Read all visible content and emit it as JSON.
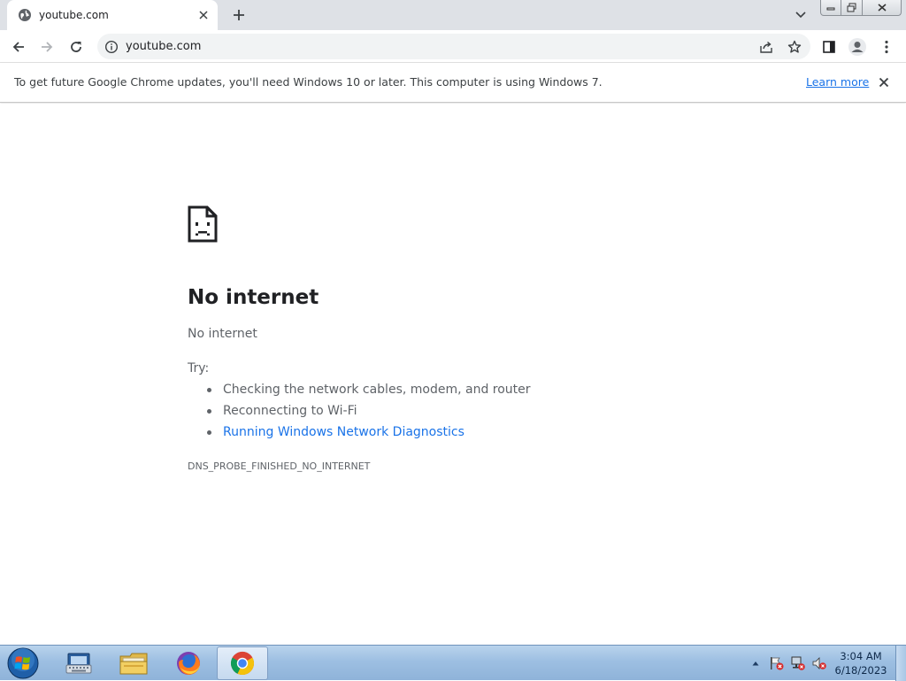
{
  "browser": {
    "tab": {
      "title": "youtube.com",
      "favicon": "globe-icon"
    },
    "toolbar": {
      "url": "youtube.com"
    }
  },
  "infobar": {
    "message": "To get future Google Chrome updates, you'll need Windows 10 or later. This computer is using Windows 7.",
    "link": "Learn more"
  },
  "error": {
    "title": "No internet",
    "subtitle": "No internet",
    "try_label": "Try:",
    "suggestions": [
      "Checking the network cables, modem, and router",
      "Reconnecting to Wi-Fi",
      "Running Windows Network Diagnostics"
    ],
    "code": "DNS_PROBE_FINISHED_NO_INTERNET"
  },
  "taskbar": {
    "apps": [
      "on-screen-keyboard-icon",
      "file-explorer-icon",
      "firefox-icon",
      "chrome-icon"
    ],
    "active_app": "chrome-icon",
    "clock": {
      "time": "3:04 AM",
      "date": "6/18/2023"
    }
  },
  "colors": {
    "link": "#1a73e8",
    "tabstrip": "#dee1e6",
    "taskbar": "#9dbfe2"
  }
}
